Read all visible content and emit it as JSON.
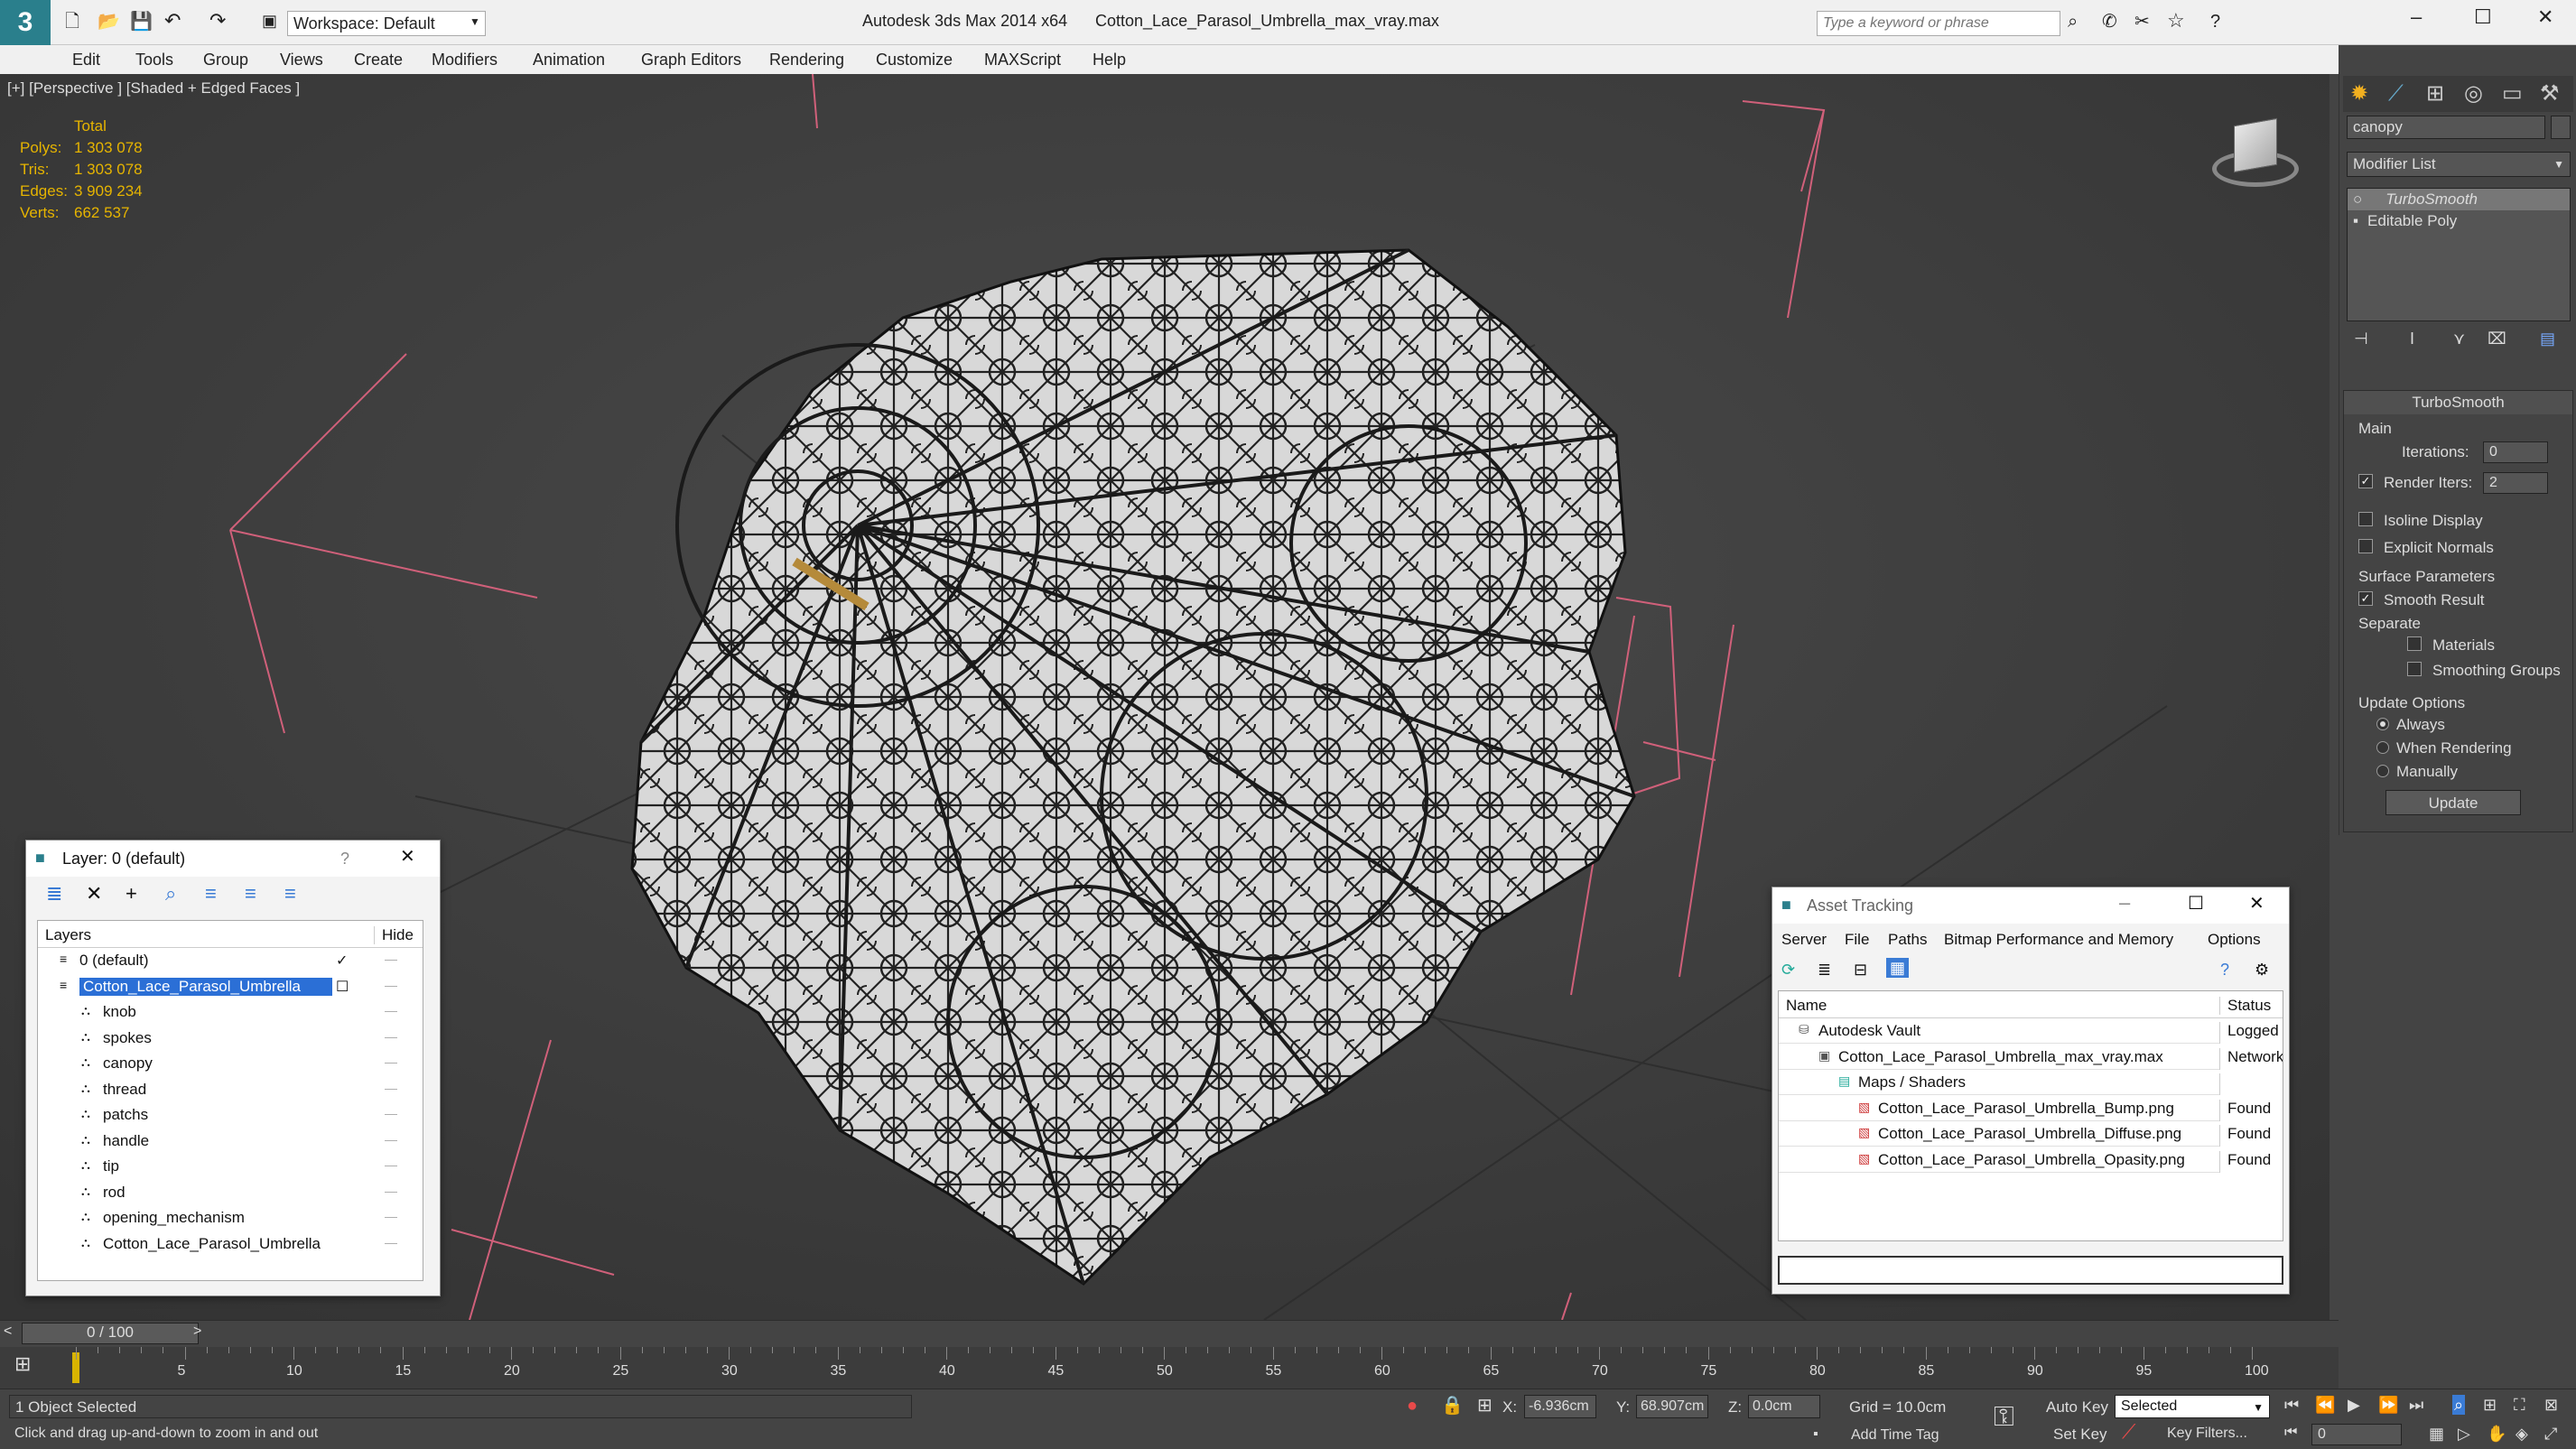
{
  "app": {
    "title": "Autodesk 3ds Max  2014 x64",
    "filename": "Cotton_Lace_Parasol_Umbrella_max_vray.max",
    "workspace": "Workspace: Default",
    "search_placeholder": "Type a keyword or phrase"
  },
  "menu": [
    "Edit",
    "Tools",
    "Group",
    "Views",
    "Create",
    "Modifiers",
    "Animation",
    "Graph Editors",
    "Rendering",
    "Customize",
    "MAXScript",
    "Help"
  ],
  "viewport": {
    "label": "[+] [Perspective ] [Shaded + Edged Faces ]",
    "stats_header": "Total",
    "stats": [
      {
        "label": "Polys:",
        "value": "1 303 078"
      },
      {
        "label": "Tris:",
        "value": "1 303 078"
      },
      {
        "label": "Edges:",
        "value": "3 909 234"
      },
      {
        "label": "Verts:",
        "value": "662 537"
      }
    ]
  },
  "command_panel": {
    "object_name": "canopy",
    "modifier_list": "Modifier List",
    "stack": [
      "TurboSmooth",
      "Editable Poly"
    ],
    "rollout_title": "TurboSmooth",
    "main_label": "Main",
    "iterations_label": "Iterations:",
    "iterations_value": "0",
    "render_iters_label": "Render Iters:",
    "render_iters_value": "2",
    "isoline": "Isoline Display",
    "explicit_normals": "Explicit Normals",
    "surface_params": "Surface Parameters",
    "smooth_result": "Smooth Result",
    "separate": "Separate",
    "materials": "Materials",
    "smoothing_groups": "Smoothing Groups",
    "update_options": "Update Options",
    "always": "Always",
    "when_rendering": "When Rendering",
    "manually": "Manually",
    "update_btn": "Update"
  },
  "layer_window": {
    "title": "Layer: 0 (default)",
    "help": "?",
    "col_layers": "Layers",
    "col_hide": "Hide",
    "layers": [
      {
        "name": "0 (default)",
        "indent": 0,
        "selected": false
      },
      {
        "name": "Cotton_Lace_Parasol_Umbrella",
        "indent": 0,
        "selected": true
      },
      {
        "name": "knob",
        "indent": 1,
        "selected": false
      },
      {
        "name": "spokes",
        "indent": 1,
        "selected": false
      },
      {
        "name": "canopy",
        "indent": 1,
        "selected": false
      },
      {
        "name": "thread",
        "indent": 1,
        "selected": false
      },
      {
        "name": "patchs",
        "indent": 1,
        "selected": false
      },
      {
        "name": "handle",
        "indent": 1,
        "selected": false
      },
      {
        "name": "tip",
        "indent": 1,
        "selected": false
      },
      {
        "name": "rod",
        "indent": 1,
        "selected": false
      },
      {
        "name": "opening_mechanism",
        "indent": 1,
        "selected": false
      },
      {
        "name": "Cotton_Lace_Parasol_Umbrella",
        "indent": 1,
        "selected": false
      }
    ]
  },
  "asset_window": {
    "title": "Asset Tracking",
    "menu": [
      "Server",
      "File",
      "Paths",
      "Bitmap Performance and Memory",
      "Options"
    ],
    "col_name": "Name",
    "col_status": "Status",
    "rows": [
      {
        "name": "Autodesk Vault",
        "status": "Logged",
        "indent": 1
      },
      {
        "name": "Cotton_Lace_Parasol_Umbrella_max_vray.max",
        "status": "Network",
        "indent": 2
      },
      {
        "name": "Maps / Shaders",
        "status": "",
        "indent": 3
      },
      {
        "name": "Cotton_Lace_Parasol_Umbrella_Bump.png",
        "status": "Found",
        "indent": 4
      },
      {
        "name": "Cotton_Lace_Parasol_Umbrella_Diffuse.png",
        "status": "Found",
        "indent": 4
      },
      {
        "name": "Cotton_Lace_Parasol_Umbrella_Opasity.png",
        "status": "Found",
        "indent": 4
      }
    ]
  },
  "timeline": {
    "frame_display": "0 / 100",
    "ticks": [
      "5",
      "10",
      "15",
      "20",
      "25",
      "30",
      "35",
      "40",
      "45",
      "50",
      "55",
      "60",
      "65",
      "70",
      "75",
      "80",
      "85",
      "90",
      "95",
      "100"
    ]
  },
  "status": {
    "selection": "1 Object Selected",
    "prompt": "Click and drag up-and-down to zoom in and out",
    "x_label": "X:",
    "x_value": "-6.936cm",
    "y_label": "Y:",
    "y_value": "68.907cm",
    "z_label": "Z:",
    "z_value": "0.0cm",
    "grid": "Grid = 10.0cm",
    "add_time_tag": "Add Time Tag",
    "auto_key": "Auto Key",
    "set_key": "Set Key",
    "selected": "Selected",
    "key_filters": "Key Filters...",
    "frame": "0"
  },
  "colors": {
    "accent": "#0078d7",
    "selection": "#2b6fd6",
    "stat_yellow": "#e6b400",
    "grid_red": "#d0607a"
  }
}
